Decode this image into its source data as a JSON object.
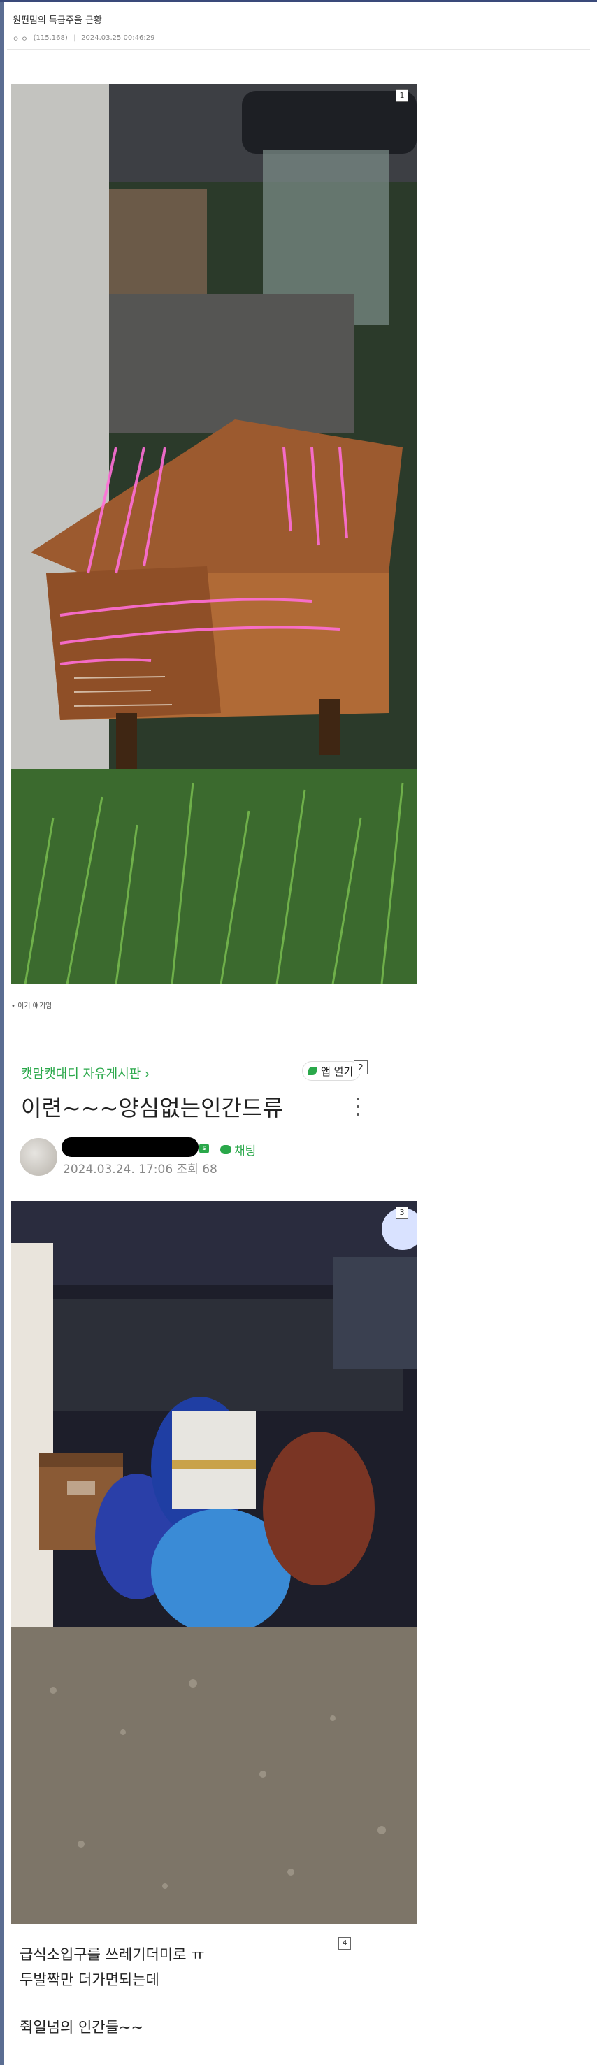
{
  "header": {
    "title": "원편밈의 특급주을 근황",
    "author": "ㅇ ㅇ",
    "ip": "(115.168)",
    "datetime": "2024.03.25 00:46:29"
  },
  "images": [
    {
      "page": "1",
      "description_icon": "photo-wooden-box-icon"
    },
    {
      "page": "3",
      "description_icon": "photo-trash-pile-icon"
    }
  ],
  "caption": "• 이거 얘기임",
  "cafe": {
    "board_name": "캣맘캣대디 자유게시판 ›",
    "app_open": "앱 열기",
    "page_badge": "2",
    "post_title": "이련~~~양심없는인간드류",
    "manager_badge": "s",
    "chat_label": "채팅",
    "meta": "2024.03.24. 17:06  조회 68"
  },
  "body": {
    "page_badge": "4",
    "lines": [
      "급식소입구를 쓰레기더미로 ㅠ",
      "두발짝만 더가면되는데",
      "",
      "쥑일넘의 인간들~~"
    ]
  },
  "colors": {
    "accent_green": "#2aa84a",
    "pink_marker": "#ff6fd8"
  }
}
